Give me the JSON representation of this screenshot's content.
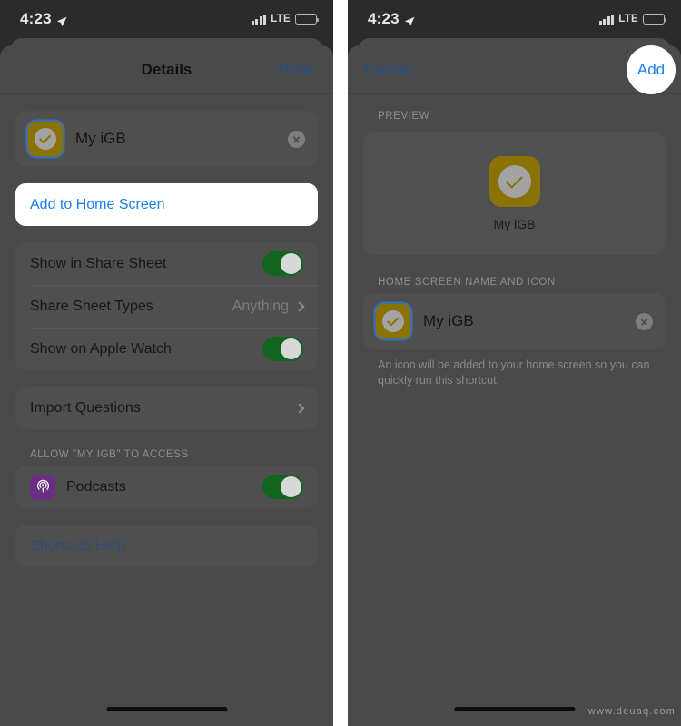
{
  "status_bar": {
    "time": "4:23",
    "location_icon": "location-arrow-icon",
    "signal_icon": "cellular-bars-icon",
    "network": "LTE",
    "battery_icon": "battery-full-icon"
  },
  "left_panel": {
    "nav": {
      "title": "Details",
      "done_label": "Done"
    },
    "name_row": {
      "icon": "shortcut-check-icon",
      "name": "My iGB",
      "clear_icon": "clear-circle-icon"
    },
    "primary_action": {
      "label": "Add to Home Screen"
    },
    "settings_rows": [
      {
        "label": "Show in Share Sheet",
        "control": "toggle",
        "state": "on"
      },
      {
        "label": "Share Sheet Types",
        "value": "Anything",
        "control": "chevron"
      },
      {
        "label": "Show on Apple Watch",
        "control": "toggle",
        "state": "on"
      }
    ],
    "import_row": {
      "label": "Import Questions",
      "control": "chevron"
    },
    "access_section": {
      "header": "ALLOW \"MY IGB\" TO ACCESS",
      "items": [
        {
          "label": "Podcasts",
          "icon": "podcasts-icon",
          "control": "toggle",
          "state": "on"
        }
      ]
    },
    "help_row": {
      "label": "Shortcuts Help"
    }
  },
  "right_panel": {
    "nav": {
      "cancel_label": "Cancel",
      "add_label": "Add"
    },
    "preview_section": {
      "header": "PREVIEW",
      "icon": "shortcut-check-icon",
      "name": "My iGB"
    },
    "name_icon_section": {
      "header": "HOME SCREEN NAME AND ICON",
      "icon": "shortcut-check-icon",
      "name": "My iGB",
      "clear_icon": "clear-circle-icon",
      "footnote": "An icon will be added to your home screen so you can quickly run this shortcut."
    }
  },
  "watermark": "www.deuaq.com",
  "colors": {
    "accent_blue": "#1a7ff0",
    "toggle_green": "#13641f",
    "shortcut_icon": "#8a7205",
    "podcasts_purple": "#6c2d85",
    "sheet_bg": "#4a4a4a",
    "card_bg": "#4f4f4f"
  }
}
